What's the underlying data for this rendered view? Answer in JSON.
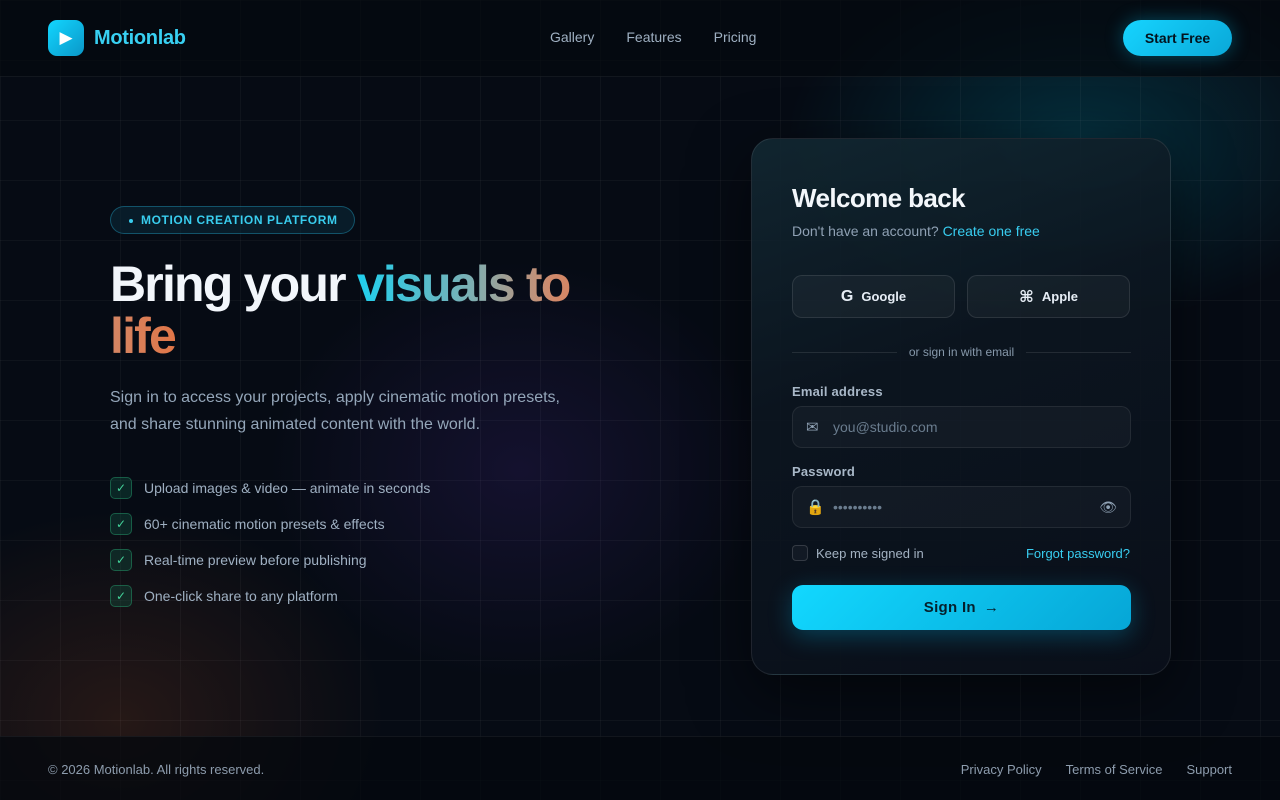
{
  "brand": {
    "name": "Motionlab",
    "logo_icon": "play-icon"
  },
  "nav": {
    "items": [
      "Gallery",
      "Features",
      "Pricing"
    ],
    "cta": "Start Free"
  },
  "hero": {
    "badge": "MOTION CREATION PLATFORM",
    "title_plain": "Bring your ",
    "title_gradient": "visuals to life",
    "subtitle": "Sign in to access your projects, apply cinematic motion presets, and share stunning animated content with the world.",
    "features": [
      "Upload images & video — animate in seconds",
      "60+ cinematic motion presets & effects",
      "Real-time preview before publishing",
      "One-click share to any platform"
    ]
  },
  "login": {
    "title": "Welcome back",
    "no_account": "Don't have an account?",
    "create_link": "Create one free",
    "google_label": "Google",
    "apple_label": "Apple",
    "divider": "or sign in with email",
    "email_label": "Email address",
    "email_placeholder": "you@studio.com",
    "email_value": "",
    "password_label": "Password",
    "password_placeholder": "••••••••••",
    "password_value": "",
    "remember_label": "Keep me signed in",
    "remember_checked": false,
    "forgot_label": "Forgot password?",
    "submit_label": "Sign In",
    "submit_arrow": "→"
  },
  "footer": {
    "copyright": "© 2026 Motionlab. All rights reserved.",
    "links": [
      "Privacy Policy",
      "Terms of Service",
      "Support"
    ]
  },
  "colors": {
    "accent": "#16d4ff",
    "background": "#060b14",
    "link": "#38cdf0",
    "check": "#43d39a"
  }
}
